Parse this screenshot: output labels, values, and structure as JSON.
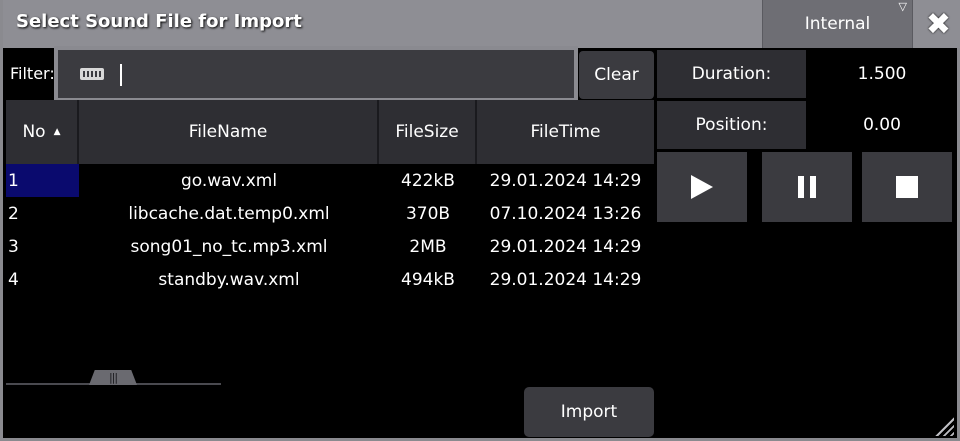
{
  "window": {
    "title": "Select Sound File for Import",
    "source": "Internal",
    "close_icon": "close-icon"
  },
  "filter": {
    "label": "Filter:",
    "value": "",
    "keyboard_icon": "keyboard-icon",
    "clear_label": "Clear"
  },
  "table": {
    "columns": [
      "No",
      "FileName",
      "FileSize",
      "FileTime"
    ],
    "sort_column": "No",
    "sort_direction": "ascending",
    "rows": [
      {
        "no": "1",
        "name": "go.wav.xml",
        "size": "422kB",
        "time": "29.01.2024 14:29",
        "selected": true
      },
      {
        "no": "2",
        "name": "libcache.dat.temp0.xml",
        "size": "370B",
        "time": "07.10.2024 13:26",
        "selected": false
      },
      {
        "no": "3",
        "name": "song01_no_tc.mp3.xml",
        "size": "2MB",
        "time": "29.01.2024 14:29",
        "selected": false
      },
      {
        "no": "4",
        "name": "standby.wav.xml",
        "size": "494kB",
        "time": "29.01.2024 14:29",
        "selected": false
      }
    ]
  },
  "player": {
    "duration_label": "Duration:",
    "duration_value": "1.500",
    "position_label": "Position:",
    "position_value": "0.00",
    "controls": [
      "play-icon",
      "pause-icon",
      "stop-icon"
    ]
  },
  "actions": {
    "import_label": "Import"
  },
  "colors": {
    "titlebar": "#8e8e94",
    "button": "#3b3b40",
    "selection": "#0a0a6e"
  }
}
